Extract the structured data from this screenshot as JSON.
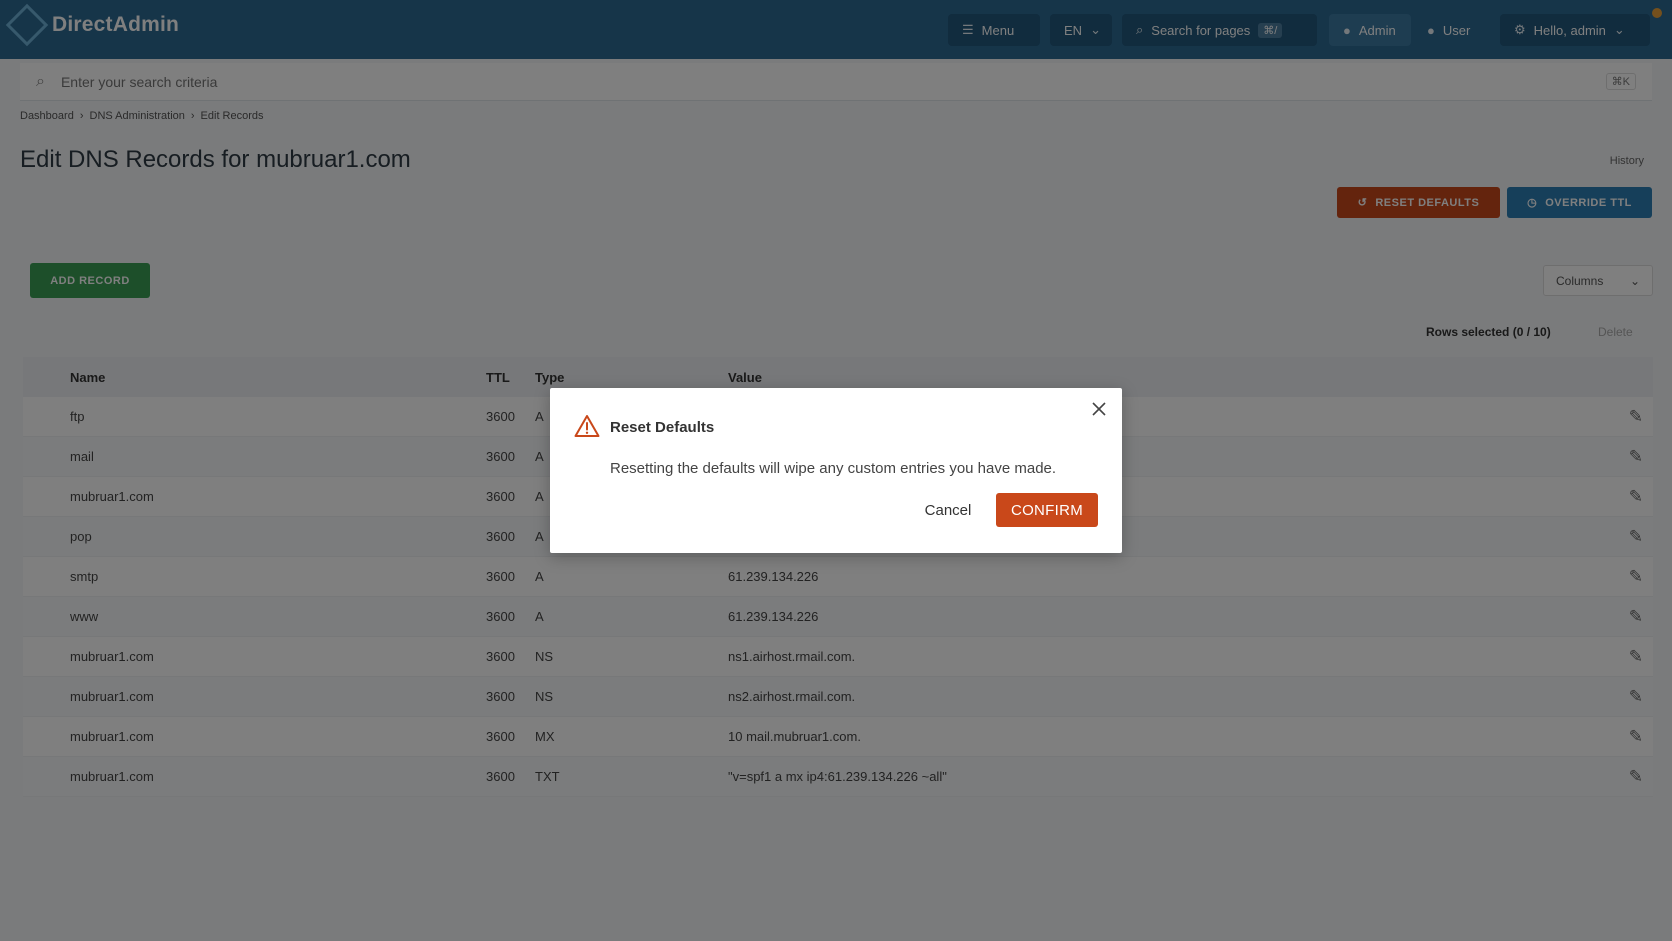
{
  "app": {
    "brand": "DirectAdmin",
    "colors": {
      "header": "#2c6a93",
      "danger": "#c9481a",
      "primary": "#2d7fb5",
      "success": "#3b9e55"
    }
  },
  "topbar": {
    "menu_label": "Menu",
    "language": "EN",
    "search_pages_label": "Search for pages",
    "search_kbd": "⌘/",
    "admin_label": "Admin",
    "user_label": "User",
    "account_label": "Hello, admin"
  },
  "search": {
    "placeholder": "Enter your search criteria",
    "kbd": "⌘K"
  },
  "breadcrumb": {
    "items": [
      "Dashboard",
      "DNS Administration",
      "Edit Records"
    ],
    "sep": "›"
  },
  "page": {
    "title": "Edit DNS Records for mubruar1.com",
    "history_label": "History"
  },
  "actions": {
    "reset_label": "RESET DEFAULTS",
    "ttl_label": "OVERRIDE TTL",
    "add_label": "ADD RECORD",
    "columns_label": "Columns"
  },
  "selection": {
    "rows_selected": "Rows selected (0 / 10)",
    "delete_label": "Delete"
  },
  "table": {
    "headers": {
      "name": "Name",
      "ttl": "TTL",
      "type": "Type",
      "value": "Value"
    },
    "rows": [
      {
        "name": "ftp",
        "ttl": "3600",
        "type": "A",
        "value": ""
      },
      {
        "name": "mail",
        "ttl": "3600",
        "type": "A",
        "value": ""
      },
      {
        "name": "mubruar1.com",
        "ttl": "3600",
        "type": "A",
        "value": ""
      },
      {
        "name": "pop",
        "ttl": "3600",
        "type": "A",
        "value": ""
      },
      {
        "name": "smtp",
        "ttl": "3600",
        "type": "A",
        "value": "61.239.134.226"
      },
      {
        "name": "www",
        "ttl": "3600",
        "type": "A",
        "value": "61.239.134.226"
      },
      {
        "name": "mubruar1.com",
        "ttl": "3600",
        "type": "NS",
        "value": "ns1.airhost.rmail.com."
      },
      {
        "name": "mubruar1.com",
        "ttl": "3600",
        "type": "NS",
        "value": "ns2.airhost.rmail.com."
      },
      {
        "name": "mubruar1.com",
        "ttl": "3600",
        "type": "MX",
        "value": "10 mail.mubruar1.com."
      },
      {
        "name": "mubruar1.com",
        "ttl": "3600",
        "type": "TXT",
        "value": "\"v=spf1 a mx ip4:61.239.134.226 ~all\""
      }
    ]
  },
  "modal": {
    "title": "Reset Defaults",
    "body": "Resetting the defaults will wipe any custom entries you have made.",
    "cancel_label": "Cancel",
    "confirm_label": "CONFIRM"
  }
}
